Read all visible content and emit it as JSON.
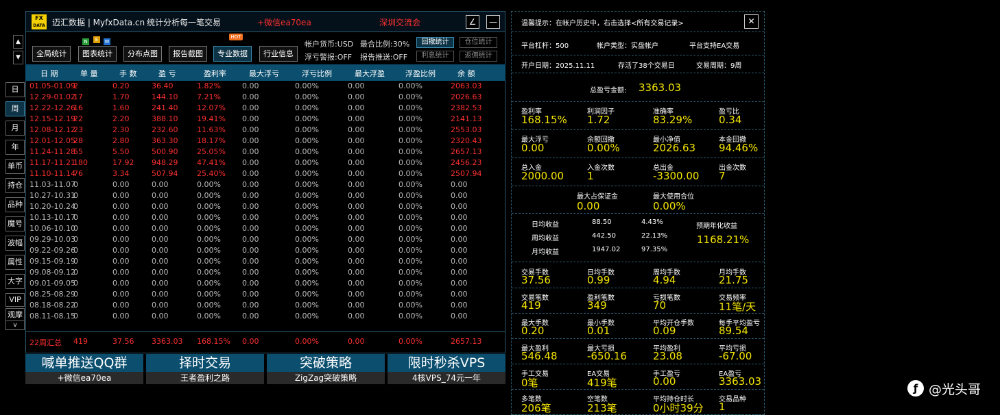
{
  "header": {
    "logo_top": "FX",
    "logo_bottom": "DATA",
    "title": "迈汇数据 | MyfxData.cn",
    "subtitle": "统计分析每一笔交易",
    "promo_wechat": "+微信ea70ea",
    "promo_group": "深圳交流会",
    "edit_icon": "∠",
    "minimize_icon": "—"
  },
  "toolbar": {
    "buttons": [
      "全局统计",
      "图表统计",
      "分布点图",
      "报告截图",
      "专业数据",
      "行业信息"
    ],
    "badges": {
      "new_n": "N",
      "new_e": "E",
      "new_w": "W",
      "hot": "HOT"
    },
    "currency": "帐户货币:USD",
    "max_ratio": "最合比例:30%",
    "float_alert": "浮亏警报:OFF",
    "report_push": "报告推送:OFF",
    "small_buttons": [
      "回撤统计",
      "仓位统计",
      "利息统计",
      "返佣统计"
    ]
  },
  "sidebar": {
    "up": "▲",
    "down": "▼",
    "items": [
      "日",
      "周",
      "月",
      "年",
      "单币",
      "持仓",
      "品种",
      "魔号",
      "波幅",
      "属性",
      "大字",
      "VIP",
      "观摩",
      "v"
    ]
  },
  "table": {
    "columns": [
      "日 期",
      "单 量",
      "手 数",
      "盈 亏",
      "盈利率",
      "最大浮亏",
      "浮亏比例",
      "最大浮盈",
      "浮盈比例",
      "余 额"
    ],
    "rows": [
      [
        "01.05-01.09",
        "2",
        "0.20",
        "36.40",
        "1.82%",
        "0.00",
        "0.00%",
        "0.00",
        "0.00%",
        "2063.03"
      ],
      [
        "12.29-01.02",
        "17",
        "1.70",
        "144.10",
        "7.21%",
        "0.00",
        "0.00%",
        "0.00",
        "0.00%",
        "2026.63"
      ],
      [
        "12.22-12.26",
        "16",
        "1.60",
        "241.40",
        "12.07%",
        "0.00",
        "0.00%",
        "0.00",
        "0.00%",
        "2382.53"
      ],
      [
        "12.15-12.19",
        "22",
        "2.20",
        "388.10",
        "19.41%",
        "0.00",
        "0.00%",
        "0.00",
        "0.00%",
        "2141.13"
      ],
      [
        "12.08-12.12",
        "23",
        "2.30",
        "232.60",
        "11.63%",
        "0.00",
        "0.00%",
        "0.00",
        "0.00%",
        "2553.03"
      ],
      [
        "12.01-12.05",
        "28",
        "2.80",
        "363.30",
        "18.17%",
        "0.00",
        "0.00%",
        "0.00",
        "0.00%",
        "2320.43"
      ],
      [
        "11.24-11.28",
        "55",
        "5.50",
        "500.90",
        "25.05%",
        "0.00",
        "0.00%",
        "0.00",
        "0.00%",
        "2657.13"
      ],
      [
        "11.17-11.21",
        "180",
        "17.92",
        "948.29",
        "47.41%",
        "0.00",
        "0.00%",
        "0.00",
        "0.00%",
        "2456.23"
      ],
      [
        "11.10-11.14",
        "76",
        "3.34",
        "507.94",
        "25.40%",
        "0.00",
        "0.00%",
        "0.00",
        "0.00%",
        "2507.94"
      ],
      [
        "11.03-11.07",
        "0",
        "0.00",
        "0.00",
        "0.00%",
        "0.00",
        "0.00%",
        "0.00",
        "0.00%",
        "0.00"
      ],
      [
        "10.27-10.31",
        "0",
        "0.00",
        "0.00",
        "0.00%",
        "0.00",
        "0.00%",
        "0.00",
        "0.00%",
        "0.00"
      ],
      [
        "10.20-10.24",
        "0",
        "0.00",
        "0.00",
        "0.00%",
        "0.00",
        "0.00%",
        "0.00",
        "0.00%",
        "0.00"
      ],
      [
        "10.13-10.17",
        "0",
        "0.00",
        "0.00",
        "0.00%",
        "0.00",
        "0.00%",
        "0.00",
        "0.00%",
        "0.00"
      ],
      [
        "10.06-10.10",
        "0",
        "0.00",
        "0.00",
        "0.00%",
        "0.00",
        "0.00%",
        "0.00",
        "0.00%",
        "0.00"
      ],
      [
        "09.29-10.03",
        "0",
        "0.00",
        "0.00",
        "0.00%",
        "0.00",
        "0.00%",
        "0.00",
        "0.00%",
        "0.00"
      ],
      [
        "09.22-09.26",
        "0",
        "0.00",
        "0.00",
        "0.00%",
        "0.00",
        "0.00%",
        "0.00",
        "0.00%",
        "0.00"
      ],
      [
        "09.15-09.19",
        "0",
        "0.00",
        "0.00",
        "0.00%",
        "0.00",
        "0.00%",
        "0.00",
        "0.00%",
        "0.00"
      ],
      [
        "09.08-09.12",
        "0",
        "0.00",
        "0.00",
        "0.00%",
        "0.00",
        "0.00%",
        "0.00",
        "0.00%",
        "0.00"
      ],
      [
        "09.01-09.05",
        "0",
        "0.00",
        "0.00",
        "0.00%",
        "0.00",
        "0.00%",
        "0.00",
        "0.00%",
        "0.00"
      ],
      [
        "08.25-08.29",
        "0",
        "0.00",
        "0.00",
        "0.00%",
        "0.00",
        "0.00%",
        "0.00",
        "0.00%",
        "0.00"
      ],
      [
        "08.18-08.22",
        "0",
        "0.00",
        "0.00",
        "0.00%",
        "0.00",
        "0.00%",
        "0.00",
        "0.00%",
        "0.00"
      ],
      [
        "08.11-08.15",
        "0",
        "0.00",
        "0.00",
        "0.00%",
        "0.00",
        "0.00%",
        "0.00",
        "0.00%",
        "0.00"
      ]
    ],
    "summary": [
      "22周汇总",
      "419",
      "37.56",
      "3363.03",
      "168.15%",
      "0.00",
      "0.00%",
      "0.00",
      "0.00%",
      "2657.13"
    ]
  },
  "ads": [
    {
      "top": "喊单推送QQ群",
      "bottom": "+微信ea70ea"
    },
    {
      "top": "择时交易",
      "bottom": "王者盈利之路"
    },
    {
      "top": "突破策略",
      "bottom": "ZigZag突破策略"
    },
    {
      "top": "限时秒杀VPS",
      "bottom": "4核VPS_74元一年"
    }
  ],
  "right": {
    "tip": "温馨提示：在帐户历史中，右击选择<所有交易记录>",
    "close_icon": "✕",
    "leverage": "平台杠杆：500",
    "account_type": "帐户类型：实盘帐户",
    "ea_support": "平台支持EA交易",
    "open_date": "开户日期：2025.11.11",
    "days_alive": "存活了38个交易日",
    "period": "交易周期：9周",
    "total_pnl_label": "总盈亏金额:",
    "total_pnl": "3363.03",
    "grid1": [
      [
        "盈利率",
        "168.15%"
      ],
      [
        "利润因子",
        "1.72"
      ],
      [
        "准确率",
        "83.29%"
      ],
      [
        "盈亏比",
        "0.34"
      ],
      [
        "最大浮亏",
        "0.00"
      ],
      [
        "余额回撤",
        "0.00%"
      ],
      [
        "最小净值",
        "2026.63"
      ],
      [
        "本金回撤",
        "94.46%"
      ],
      [
        "总入金",
        "2000.00"
      ],
      [
        "入金次数",
        "1"
      ],
      [
        "总出金",
        "-3300.00"
      ],
      [
        "出金次数",
        "7"
      ]
    ],
    "margin": [
      [
        "最大占保证金",
        "0.00"
      ],
      [
        "最大使用合位",
        "0.00%"
      ]
    ],
    "avg": [
      [
        "日均收益",
        "88.50",
        "4.43%"
      ],
      [
        "周均收益",
        "442.50",
        "22.13%"
      ],
      [
        "月均收益",
        "1947.02",
        "97.35%"
      ]
    ],
    "annual_label": "预期年化收益",
    "annual_value": "1168.21%",
    "grid2": [
      [
        "交易手数",
        "37.56"
      ],
      [
        "日均手数",
        "0.99"
      ],
      [
        "周均手数",
        "4.94"
      ],
      [
        "月均手数",
        "21.75"
      ],
      [
        "交易笔数",
        "419"
      ],
      [
        "盈利笔数",
        "349"
      ],
      [
        "亏损笔数",
        "70"
      ],
      [
        "交易频率",
        "11笔/天"
      ],
      [
        "最大手数",
        "0.20"
      ],
      [
        "最小手数",
        "0.01"
      ],
      [
        "平均开仓手数",
        "0.09"
      ],
      [
        "每手平均盈亏",
        "89.54"
      ],
      [
        "最大盈利",
        "546.48"
      ],
      [
        "最大亏损",
        "-650.16"
      ],
      [
        "平均盈利",
        "23.08"
      ],
      [
        "平均亏损",
        "-67.00"
      ],
      [
        "手工交易",
        "0笔"
      ],
      [
        "EA交易",
        "419笔"
      ],
      [
        "手工盈亏",
        "0.00"
      ],
      [
        "EA盈亏",
        "3363.03"
      ],
      [
        "多笔数",
        "206笔"
      ],
      [
        "空笔数",
        "213笔"
      ],
      [
        "平均持仓时长",
        "0小时39分"
      ],
      [
        "交易品种",
        "1"
      ]
    ]
  },
  "watermark": "@光头哥"
}
